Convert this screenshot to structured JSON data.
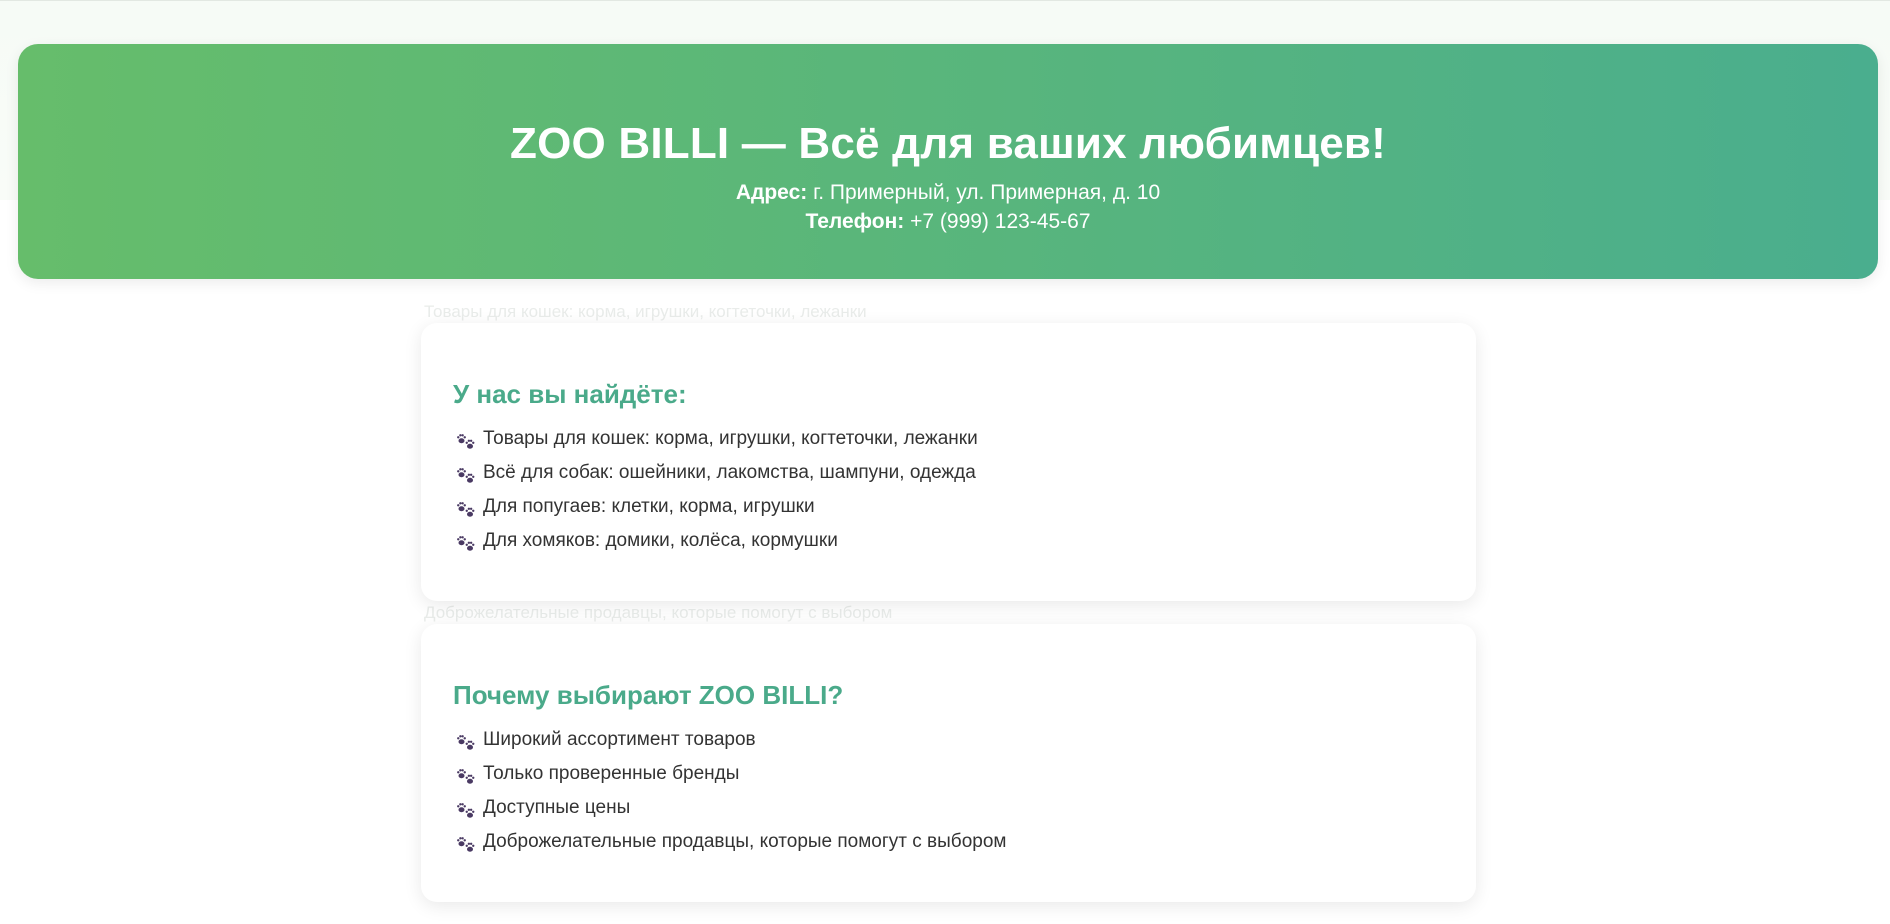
{
  "header": {
    "title": "ZOO BILLI — Всё для ваших любимцев!",
    "address_label": "Адрес:",
    "address_value": "г. Примерный, ул. Примерная, д. 10",
    "phone_label": "Телефон:",
    "phone_value": "+7 (999) 123-45-67"
  },
  "sections": [
    {
      "title": "У нас вы найдёте:",
      "items": [
        "Товары для кошек: корма, игрушки, когтеточки, лежанки",
        "Всё для собак: ошейники, лакомства, шампуни, одежда",
        "Для попугаев: клетки, корма, игрушки",
        "Для хомяков: домики, колёса, кормушки"
      ]
    },
    {
      "title": "Почему выбирают ZOO BILLI?",
      "items": [
        "Широкий ассортимент товаров",
        "Только проверенные бренды",
        "Доступные цены",
        "Доброжелательные продавцы, которые помогут с выбором"
      ]
    }
  ],
  "ghost_text": {
    "line_1": "Товары для кошек: корма, игрушки, когтеточки, лежанки",
    "line_2": "Доброжелательные продавцы, которые помогут с выбором"
  },
  "icons": {
    "list_bullet": "paw-prints-icon"
  },
  "colors": {
    "header_gradient_start": "#66bd6b",
    "header_gradient_end": "#4aae8e",
    "section_title": "#4aaa8a",
    "paw_icon": "#4a3a63"
  }
}
